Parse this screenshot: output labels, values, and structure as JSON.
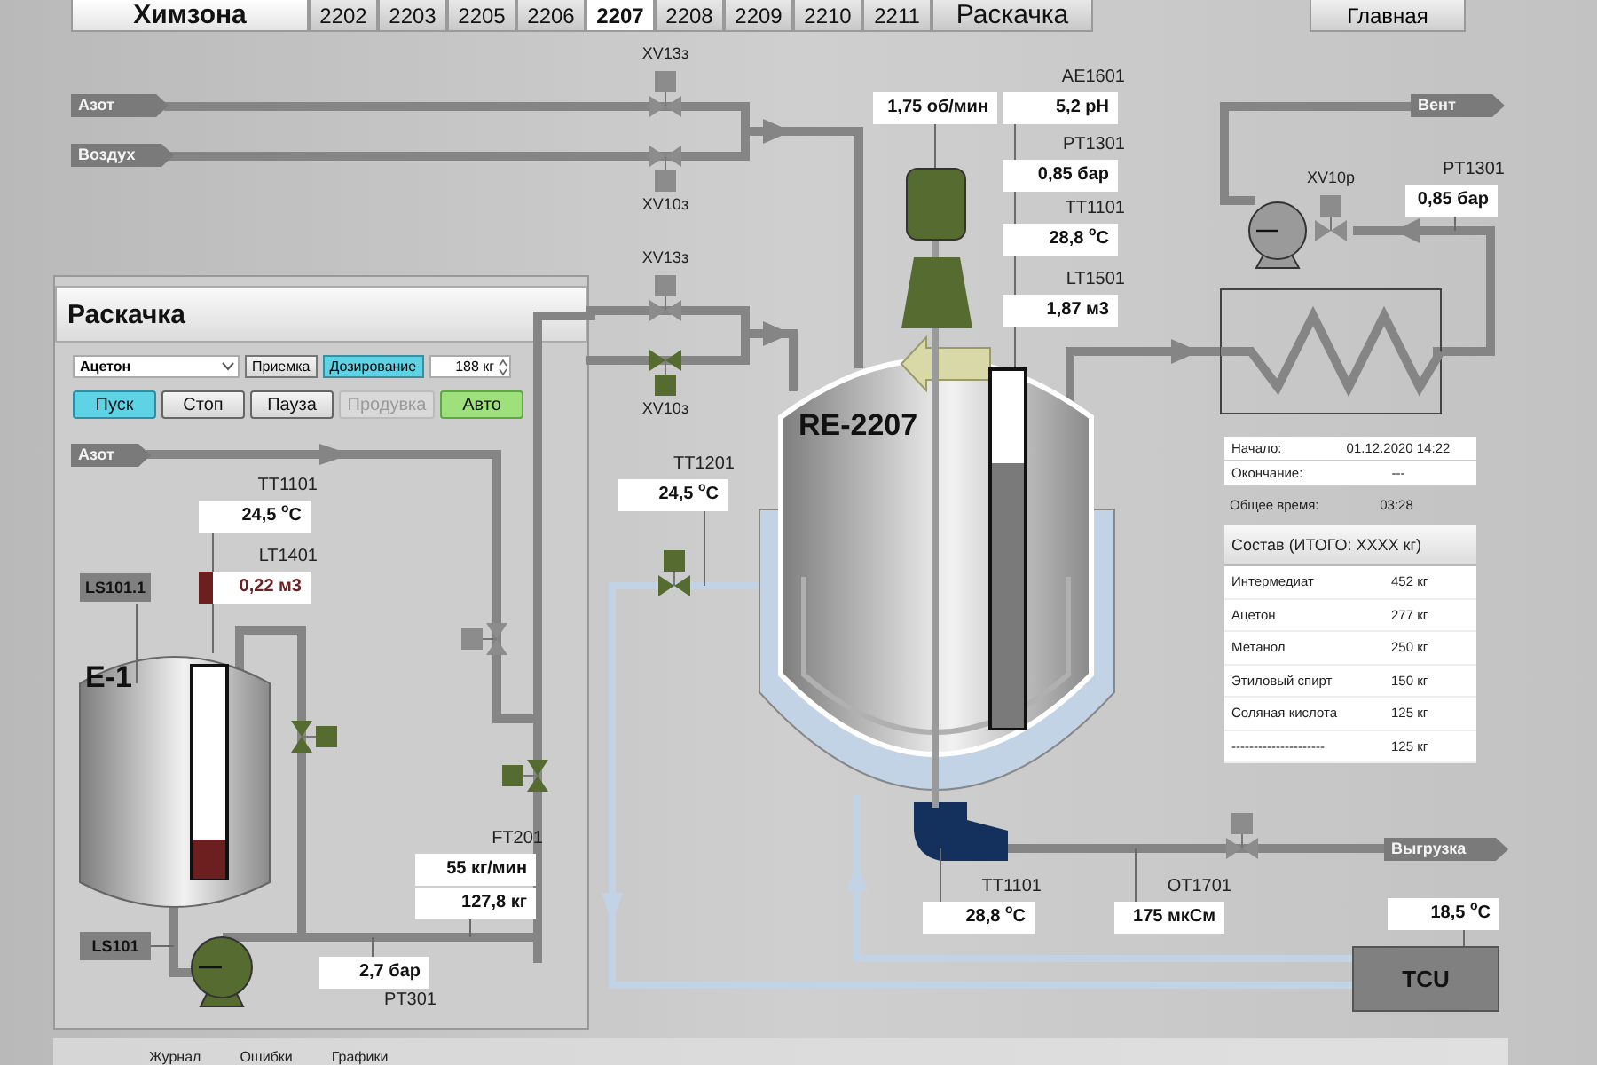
{
  "tabs": [
    {
      "label": "Химзона",
      "kind": "zone",
      "selected": false
    },
    {
      "label": "2202",
      "kind": "unit",
      "selected": false
    },
    {
      "label": "2203",
      "kind": "unit",
      "selected": false
    },
    {
      "label": "2205",
      "kind": "unit",
      "selected": false
    },
    {
      "label": "2206",
      "kind": "unit",
      "selected": false
    },
    {
      "label": "2207",
      "kind": "unit",
      "selected": true
    },
    {
      "label": "2208",
      "kind": "unit",
      "selected": false
    },
    {
      "label": "2209",
      "kind": "unit",
      "selected": false
    },
    {
      "label": "2210",
      "kind": "unit",
      "selected": false
    },
    {
      "label": "2211",
      "kind": "unit",
      "selected": false
    },
    {
      "label": "Раскачка",
      "kind": "page",
      "selected": false
    }
  ],
  "home_button": "Главная",
  "line_tags": [
    {
      "label": "Азот"
    },
    {
      "label": "Воздух"
    },
    {
      "label": "Вент"
    },
    {
      "label": "Азот"
    },
    {
      "label": "Выгрузка"
    }
  ],
  "valves": [
    {
      "tag": "XV13з",
      "open": false
    },
    {
      "tag": "XV10з",
      "open": false
    },
    {
      "tag": "XV13з",
      "open": false
    },
    {
      "tag": "XV10з",
      "open": true
    },
    {
      "tag": "XV10р",
      "open": false
    },
    {
      "open": false
    },
    {
      "open": true
    },
    {
      "open": true
    },
    {
      "open": true
    },
    {
      "open": false
    }
  ],
  "readouts": [
    {
      "value": "1,75 об/мин",
      "alarm": false
    },
    {
      "tag": "AE1601",
      "value": "5,2 pH",
      "alarm": false
    },
    {
      "tag": "PT1301",
      "value": "0,85 бар",
      "alarm": false
    },
    {
      "tag": "TT1101",
      "value": "28,8 $^{o}$C",
      "alarm": false
    },
    {
      "tag": "LT1501",
      "value": "1,87 м3",
      "alarm": false
    },
    {
      "tag": "PT1301",
      "value": "0,85 бар",
      "alarm": false
    },
    {
      "tag": "TT1201",
      "value": "24,5 $^{o}$C",
      "alarm": false
    },
    {
      "tag": "TT1101",
      "value": "24,5 $^{o}$C",
      "alarm": false
    },
    {
      "tag": "LT1401",
      "value": "0,22 м3",
      "alarm": true
    },
    {
      "tag": "FT201",
      "value": "55 кг/мин",
      "alarm": false
    },
    {
      "value": "127,8 кг",
      "alarm": false
    },
    {
      "tag": "PT301",
      "value": "2,7 бар",
      "alarm": false
    },
    {
      "tag": "TT1101",
      "value": "28,8 $^{o}$C",
      "alarm": false
    },
    {
      "tag": "OT1701",
      "value": "175 мкСм",
      "alarm": false
    },
    {
      "value": "18,5 $^{o}$C",
      "alarm": false
    }
  ],
  "vessels": [
    {
      "name": "E-1",
      "level": 0.18
    },
    {
      "name": "RE-2207",
      "level": 0.74
    }
  ],
  "level_switches": [
    "LS101.1",
    "LS101"
  ],
  "pumps": [
    {
      "running": true
    },
    {
      "running": false
    }
  ],
  "agitator": {
    "running": true
  },
  "tcu": "TCU",
  "faceplate": {
    "title": "Раскачка",
    "material": "Ацетон",
    "modes": [
      {
        "label": "Приемка",
        "selected": false
      },
      {
        "label": "Дозирование",
        "selected": true
      }
    ],
    "amount": "188 кг",
    "buttons": [
      {
        "label": "Пуск",
        "kind": "command",
        "selected": true,
        "disabled": false
      },
      {
        "label": "Стоп",
        "kind": "command",
        "selected": false,
        "disabled": false
      },
      {
        "label": "Пауза",
        "kind": "command",
        "selected": false,
        "disabled": false
      },
      {
        "label": "Продувка",
        "kind": "command",
        "selected": false,
        "disabled": true
      },
      {
        "label": "Авто",
        "kind": "toggle",
        "selected": true,
        "disabled": false
      }
    ]
  },
  "batch": {
    "rows": [
      {
        "label": "Начало:",
        "value": "01.12.2020 14:22"
      },
      {
        "label": "Окончание:",
        "value": "---"
      }
    ],
    "total": {
      "label": "Общее время:",
      "value": "03:28"
    }
  },
  "composition": {
    "title": "Состав (ИТОГО: XXXX кг)",
    "rows": [
      {
        "name": "Интермедиат",
        "amount": "452 кг"
      },
      {
        "name": "Ацетон",
        "amount": "277 кг"
      },
      {
        "name": "Метанол",
        "amount": "250 кг"
      },
      {
        "name": "Этиловый спирт",
        "amount": "150 кг"
      },
      {
        "name": "Соляная кислота",
        "amount": "125 кг"
      },
      {
        "name": "---------------------",
        "amount": "125 кг"
      }
    ]
  },
  "bottom_tabs": [
    "Журнал",
    "Ошибки",
    "Графики"
  ]
}
